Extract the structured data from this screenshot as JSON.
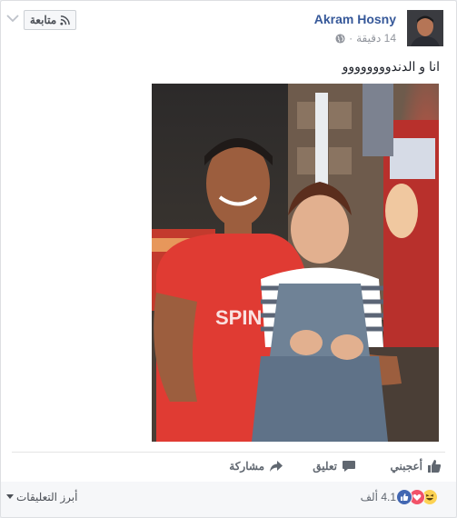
{
  "post": {
    "author": "Akram Hosny",
    "time": "14 دقيقة",
    "meta_separator": "·",
    "text": "انا و الدندوووووووو",
    "follow_label": "متابعة"
  },
  "actions": {
    "like": "أعجبني",
    "comment": "تعليق",
    "share": "مشاركة"
  },
  "footer": {
    "reaction_count": "4.1 ألف",
    "sort_label": "أبرز التعليقات"
  },
  "icons": {
    "globe": "globe-icon",
    "rss": "rss-icon",
    "like": "thumbs-up-icon",
    "comment": "speech-bubble-icon",
    "share": "share-arrow-icon",
    "chevron": "chevron-down-icon"
  },
  "colors": {
    "link": "#365899",
    "like_reaction": "#4267b2",
    "love_reaction": "#f25268",
    "haha_reaction": "#fcd253"
  }
}
